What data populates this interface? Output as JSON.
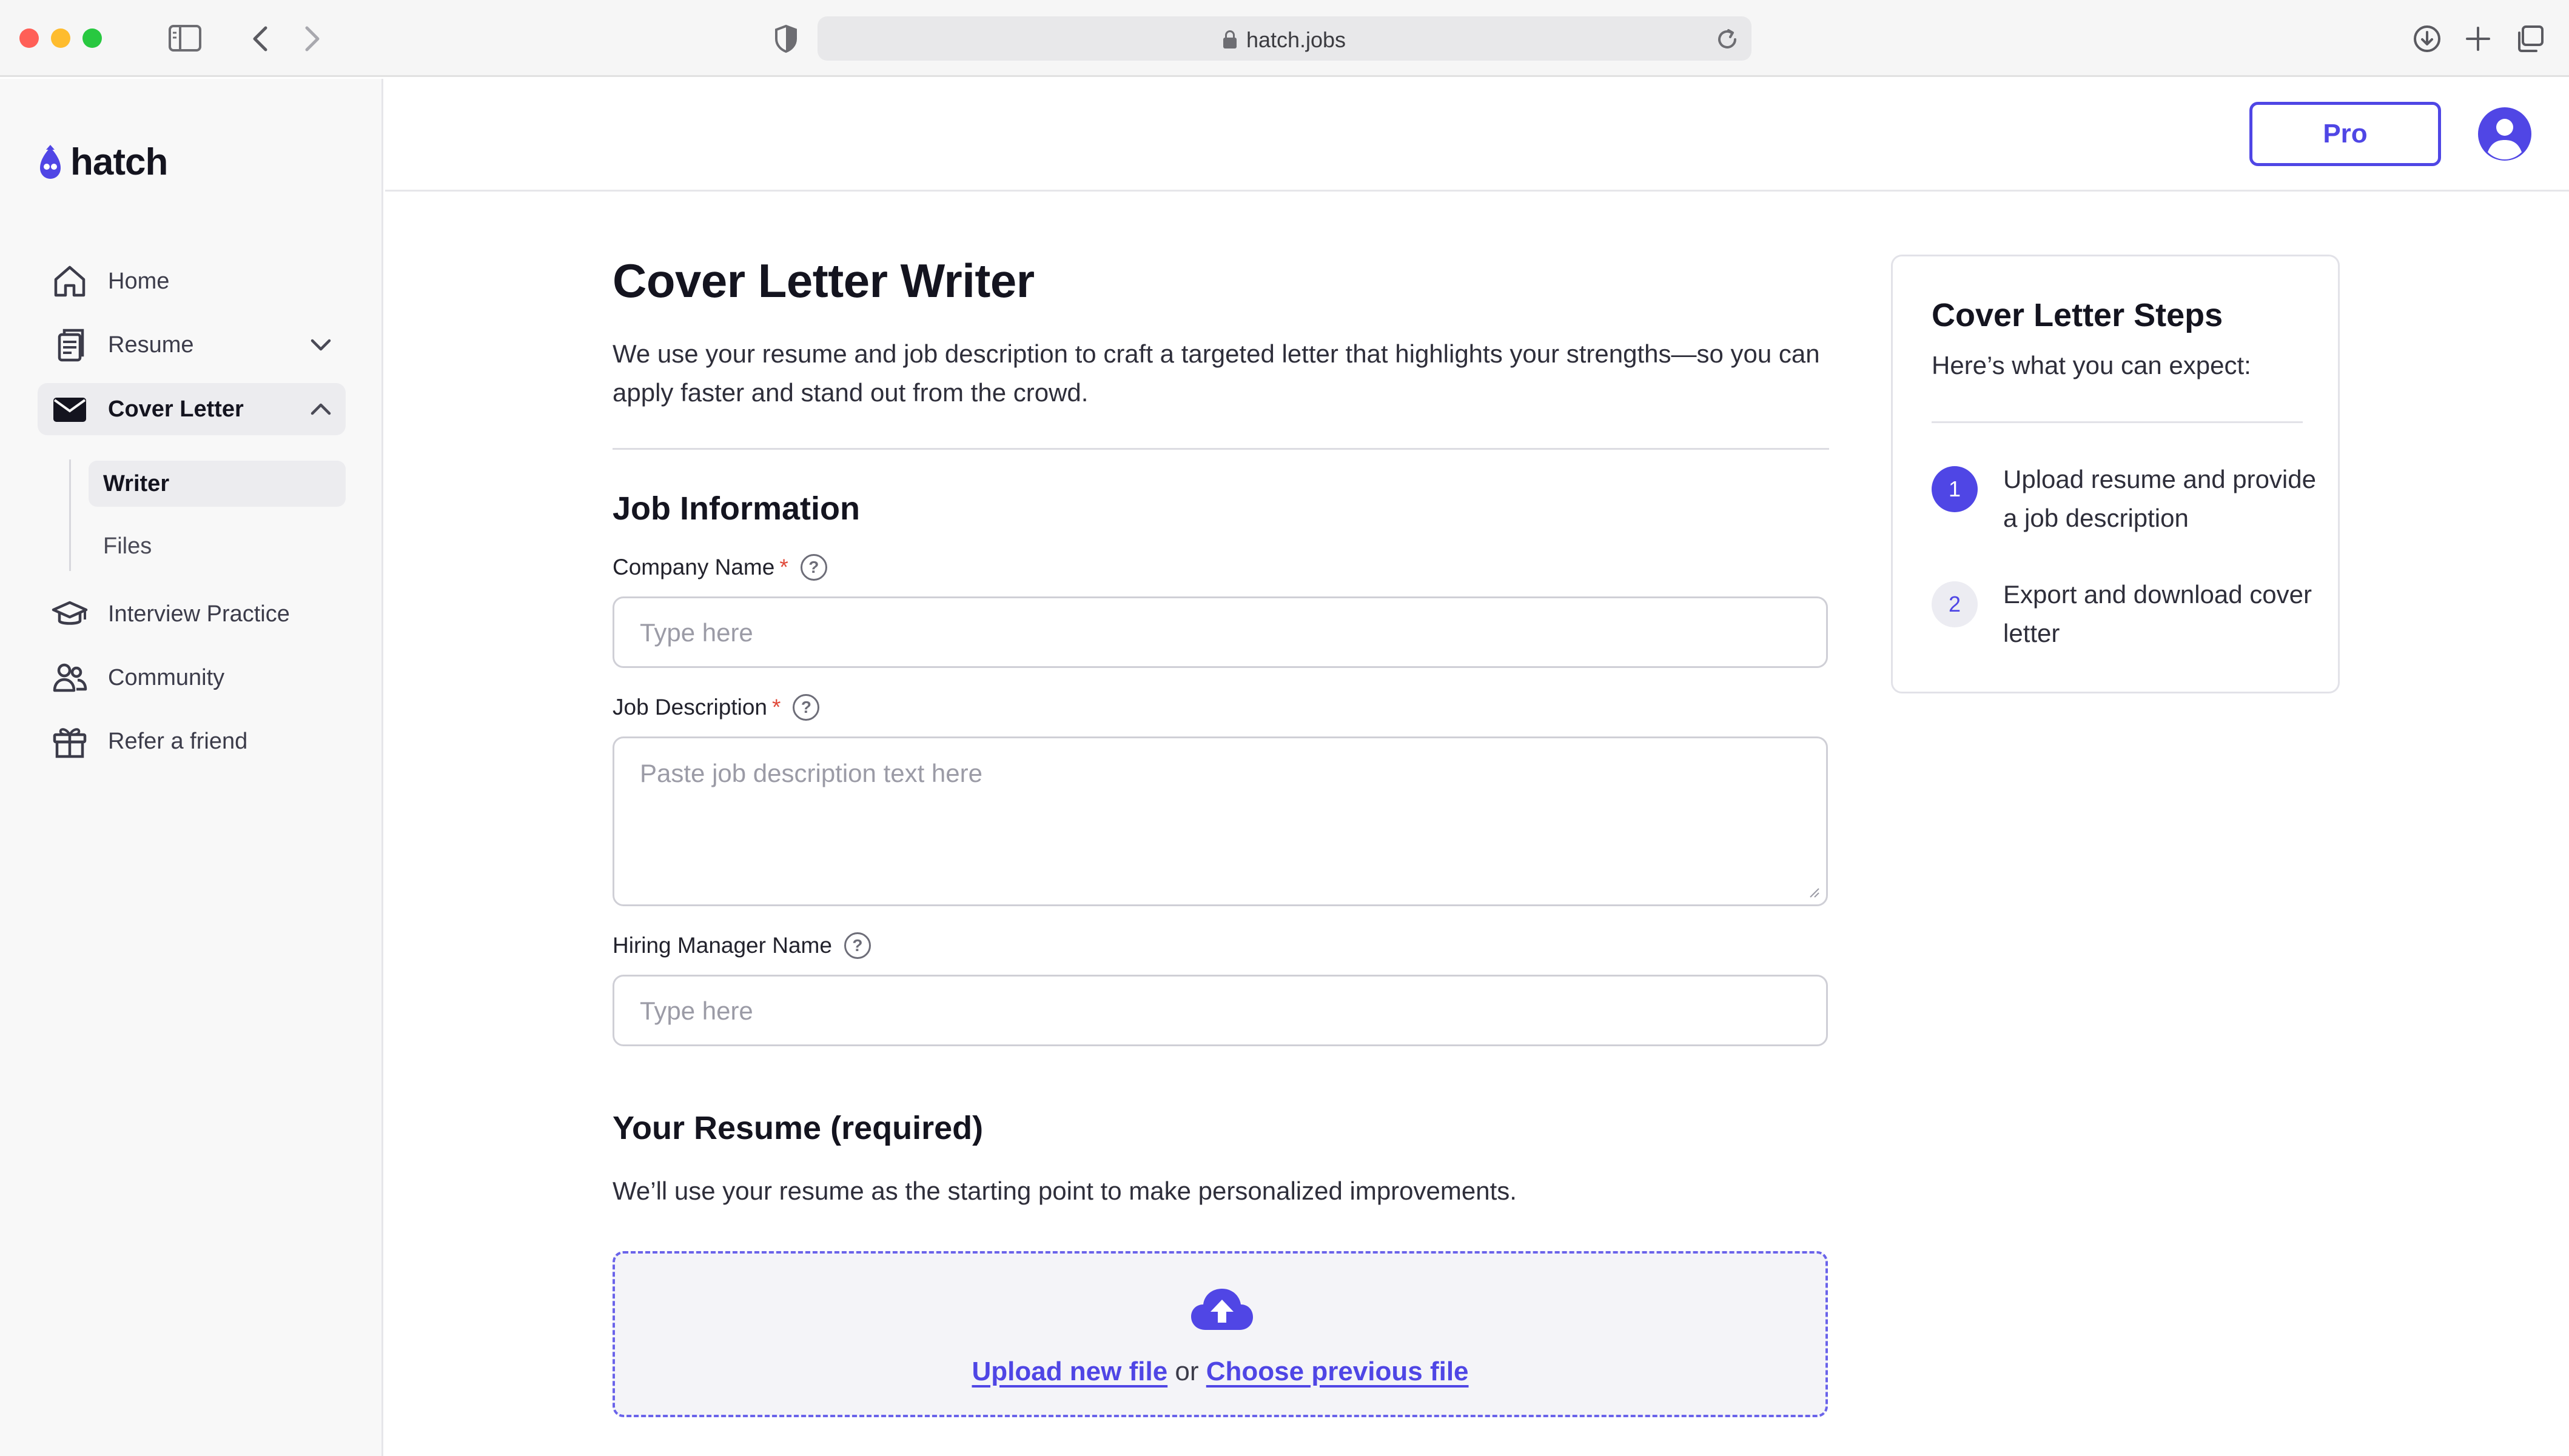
{
  "browser": {
    "url": "hatch.jobs"
  },
  "sidebar": {
    "logo": "hatch",
    "items": [
      {
        "label": "Home",
        "icon": "home-icon"
      },
      {
        "label": "Resume",
        "icon": "document-stack-icon"
      },
      {
        "label": "Cover Letter",
        "icon": "envelope-icon"
      },
      {
        "label": "Interview Practice",
        "icon": "graduation-cap-icon"
      },
      {
        "label": "Community",
        "icon": "users-icon"
      },
      {
        "label": "Refer a friend",
        "icon": "gift-icon"
      }
    ],
    "subitems": [
      {
        "label": "Writer"
      },
      {
        "label": "Files"
      }
    ]
  },
  "header": {
    "pro_label": "Pro"
  },
  "main": {
    "title": "Cover Letter Writer",
    "description": "We use your resume and job description to craft a targeted letter that highlights your strengths—so you can apply faster and stand out from the crowd.",
    "job_section_title": "Job Information",
    "company_label": "Company Name",
    "company_placeholder": "Type here",
    "job_desc_label": "Job Description",
    "job_desc_placeholder": "Paste job description text here",
    "hiring_label": "Hiring Manager Name",
    "hiring_placeholder": "Type here",
    "required_mark": "*",
    "help_glyph": "?",
    "resume_section_title": "Your Resume (required)",
    "resume_description": "We’ll use your resume as the starting point to make personalized improvements.",
    "upload_new": "Upload new file",
    "upload_or": "or",
    "choose_previous": "Choose previous file"
  },
  "steps": {
    "title": "Cover Letter Steps",
    "subtitle": "Here’s what you can expect:",
    "items": [
      {
        "num": "1",
        "text": "Upload resume and provide a job description"
      },
      {
        "num": "2",
        "text": "Export and download cover letter"
      }
    ]
  },
  "colors": {
    "accent": "#4f46e5",
    "required": "#e04a3a"
  }
}
